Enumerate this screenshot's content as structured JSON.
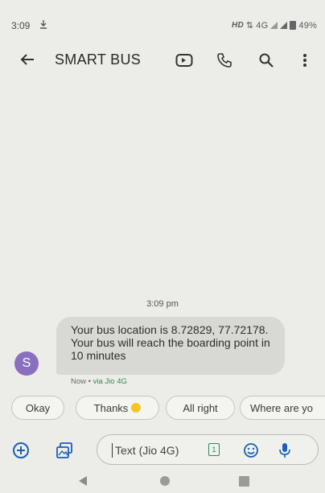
{
  "status_bar": {
    "time": "3:09",
    "download_icon": "download-arrow-icon",
    "hd_label": "HD",
    "network_label": "4G",
    "battery_percent": "49%"
  },
  "app_bar": {
    "title": "SMART BUS",
    "icons": [
      "back-arrow-icon",
      "video-call-icon",
      "phone-icon",
      "search-icon",
      "more-vert-icon"
    ]
  },
  "conversation": {
    "timestamp": "3:09 pm",
    "sender_initial": "S",
    "message_text": "Your bus location is 8.72829, 77.72178. Your bus will reach the boarding point in 10 minutes",
    "meta_time": "Now",
    "meta_separator": " • ",
    "meta_via": "via Jio 4G"
  },
  "smart_replies": [
    "Okay",
    "Thanks",
    "All right",
    "Where are yo"
  ],
  "compose": {
    "placeholder": "Text (Jio 4G)",
    "sim_number": "1",
    "icons": [
      "add-circle-icon",
      "gallery-icon",
      "emoji-icon",
      "mic-icon"
    ]
  },
  "colors": {
    "background": "#ecece8",
    "accent": "#2e8b57",
    "avatar": "#8a6fbf",
    "bubble": "#d8d8d4"
  }
}
